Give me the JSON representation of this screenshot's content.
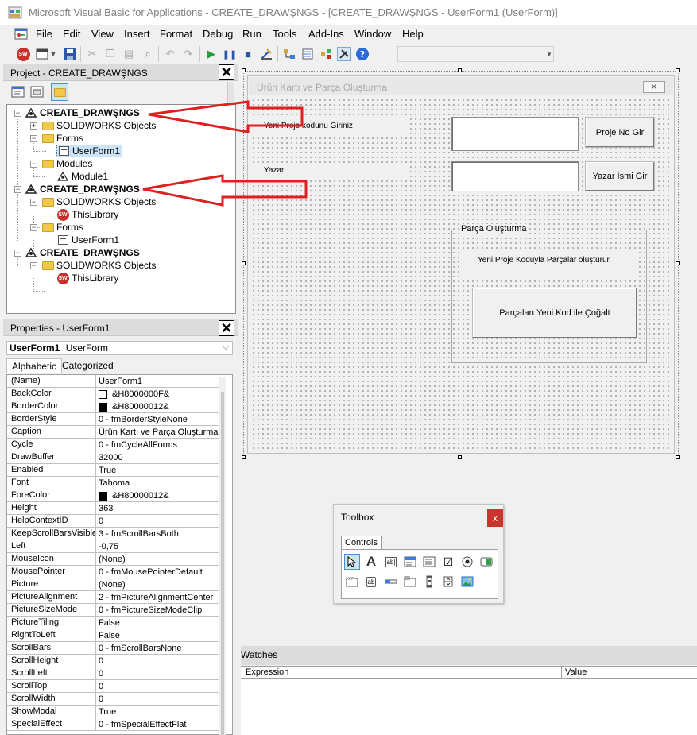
{
  "window": {
    "title": "Microsoft Visual Basic for Applications - CREATE_DRAWŞNGS - [CREATE_DRAWŞNGS - UserForm1 (UserForm)]"
  },
  "menu": [
    "File",
    "Edit",
    "View",
    "Insert",
    "Format",
    "Debug",
    "Run",
    "Tools",
    "Add-Ins",
    "Window",
    "Help"
  ],
  "project": {
    "title": "Project - CREATE_DRAWŞNGS",
    "tree": [
      {
        "label": "CREATE_DRAWŞNGS",
        "bold": true
      },
      {
        "label": "SOLIDWORKS Objects"
      },
      {
        "label": "Forms"
      },
      {
        "label": "UserForm1"
      },
      {
        "label": "Modules"
      },
      {
        "label": "Module1"
      },
      {
        "label": "CREATE_DRAWŞNGS",
        "bold": true
      },
      {
        "label": "SOLIDWORKS Objects"
      },
      {
        "label": "ThisLibrary"
      },
      {
        "label": "Forms"
      },
      {
        "label": "UserForm1"
      },
      {
        "label": "CREATE_DRAWŞNGS",
        "bold": true
      },
      {
        "label": "SOLIDWORKS Objects"
      },
      {
        "label": "ThisLibrary"
      }
    ]
  },
  "properties": {
    "title": "Properties - UserForm1",
    "object_name": "UserForm1",
    "object_type": "UserForm",
    "tabs": [
      "Alphabetic",
      "Categorized"
    ],
    "rows": [
      {
        "name": "(Name)",
        "value": "UserForm1"
      },
      {
        "name": "BackColor",
        "value": "&H8000000F&",
        "swatch": "#ffffff"
      },
      {
        "name": "BorderColor",
        "value": "&H80000012&",
        "swatch": "#000000"
      },
      {
        "name": "BorderStyle",
        "value": "0 - fmBorderStyleNone"
      },
      {
        "name": "Caption",
        "value": "Ürün Kartı ve Parça Oluşturma"
      },
      {
        "name": "Cycle",
        "value": "0 - fmCycleAllForms"
      },
      {
        "name": "DrawBuffer",
        "value": "32000"
      },
      {
        "name": "Enabled",
        "value": "True"
      },
      {
        "name": "Font",
        "value": "Tahoma"
      },
      {
        "name": "ForeColor",
        "value": "&H80000012&",
        "swatch": "#000000"
      },
      {
        "name": "Height",
        "value": "363"
      },
      {
        "name": "HelpContextID",
        "value": "0"
      },
      {
        "name": "KeepScrollBarsVisible",
        "value": "3 - fmScrollBarsBoth"
      },
      {
        "name": "Left",
        "value": "-0,75"
      },
      {
        "name": "MouseIcon",
        "value": "(None)"
      },
      {
        "name": "MousePointer",
        "value": "0 - fmMousePointerDefault"
      },
      {
        "name": "Picture",
        "value": "(None)"
      },
      {
        "name": "PictureAlignment",
        "value": "2 - fmPictureAlignmentCenter"
      },
      {
        "name": "PictureSizeMode",
        "value": "0 - fmPictureSizeModeClip"
      },
      {
        "name": "PictureTiling",
        "value": "False"
      },
      {
        "name": "RightToLeft",
        "value": "False"
      },
      {
        "name": "ScrollBars",
        "value": "0 - fmScrollBarsNone"
      },
      {
        "name": "ScrollHeight",
        "value": "0"
      },
      {
        "name": "ScrollLeft",
        "value": "0"
      },
      {
        "name": "ScrollTop",
        "value": "0"
      },
      {
        "name": "ScrollWidth",
        "value": "0"
      },
      {
        "name": "ShowModal",
        "value": "True"
      },
      {
        "name": "SpecialEffect",
        "value": "0 - fmSpecialEffectFlat"
      }
    ]
  },
  "userform": {
    "caption": "Ürün Kartı ve Parça Oluşturma",
    "label_project_code": "Yeni Proje kodunu Giriniz",
    "label_author": "Yazar",
    "button_project_no": "Proje No Gir",
    "button_author": "Yazar İsmi Gir",
    "frame_caption": "Parça Oluşturma",
    "frame_label": "Yeni Proje Koduyla Parçalar oluşturur.",
    "button_copy_parts": "Parçaları Yeni Kod ile Çoğalt"
  },
  "toolbox": {
    "title": "Toolbox",
    "close": "x",
    "tab": "Controls",
    "tool_glyphs": [
      "A",
      "ab|",
      "ab"
    ]
  },
  "watches": {
    "title": "Watches",
    "columns": [
      "Expression",
      "Value"
    ]
  },
  "colors": {
    "arrow_red": "#e02020",
    "solidworks_red": "#c9302c"
  }
}
